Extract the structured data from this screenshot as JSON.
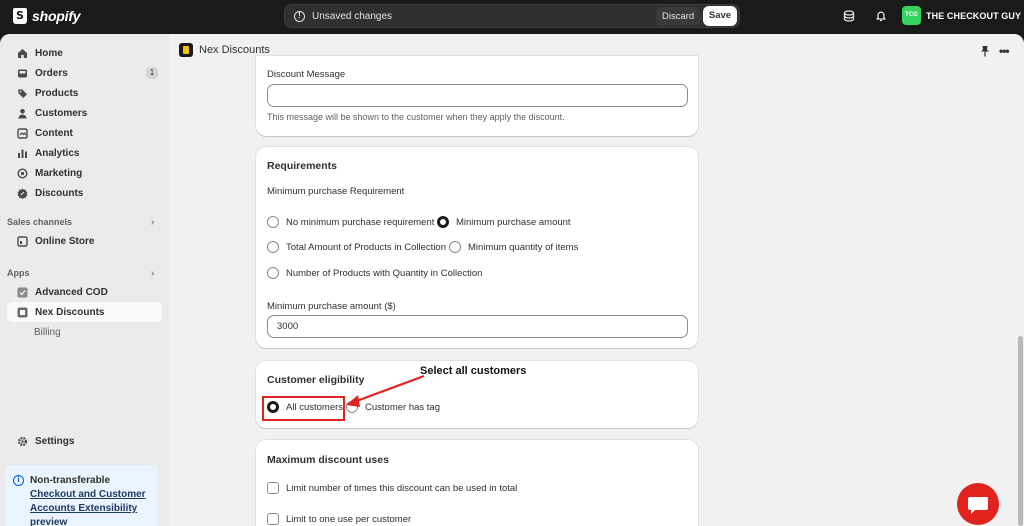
{
  "topbar": {
    "brand": "shopify",
    "unsaved_message": "Unsaved changes",
    "discard_label": "Discard",
    "save_label": "Save",
    "store_initials": "TCG",
    "store_name": "THE CHECKOUT GUY"
  },
  "sidebar": {
    "items": [
      {
        "label": "Home",
        "icon": "home-icon"
      },
      {
        "label": "Orders",
        "icon": "orders-icon",
        "count": "1"
      },
      {
        "label": "Products",
        "icon": "tag-icon"
      },
      {
        "label": "Customers",
        "icon": "person-icon"
      },
      {
        "label": "Content",
        "icon": "content-icon"
      },
      {
        "label": "Analytics",
        "icon": "bar-chart-icon"
      },
      {
        "label": "Marketing",
        "icon": "target-icon"
      },
      {
        "label": "Discounts",
        "icon": "discount-icon"
      }
    ],
    "sales_channels_heading": "Sales channels",
    "online_store": "Online Store",
    "apps_heading": "Apps",
    "apps": [
      {
        "label": "Advanced COD"
      },
      {
        "label": "Nex Discounts"
      }
    ],
    "billing": "Billing",
    "settings": "Settings",
    "notice": {
      "title": "Non-transferable",
      "link_line1": "Checkout and Customer",
      "link_line2": "Accounts Extensibility",
      "link_line3": "preview"
    }
  },
  "app_header": {
    "title": "Nex Discounts"
  },
  "discount_message_card": {
    "label": "Discount Message",
    "value": "",
    "help": "This message will be shown to the customer when they apply the discount."
  },
  "requirements_card": {
    "title": "Requirements",
    "subtitle": "Minimum purchase Requirement",
    "options": [
      {
        "label": "No minimum purchase requirement",
        "selected": false
      },
      {
        "label": "Minimum purchase amount",
        "selected": true
      },
      {
        "label": "Total Amount of Products in Collection",
        "selected": false
      },
      {
        "label": "Minimum quantity of items",
        "selected": false
      },
      {
        "label": "Number of Products with Quantity in Collection",
        "selected": false
      }
    ],
    "amount_label": "Minimum purchase amount ($)",
    "amount_value": "3000"
  },
  "eligibility_card": {
    "title": "Customer eligibility",
    "options": [
      {
        "label": "All customers",
        "selected": true
      },
      {
        "label": "Customer has tag",
        "selected": false
      }
    ]
  },
  "annotation": {
    "text": "Select all customers",
    "color": "#e02424"
  },
  "max_uses_card": {
    "title": "Maximum discount uses",
    "options": [
      {
        "label": "Limit number of times this discount can be used in total",
        "checked": false
      },
      {
        "label": "Limit to one use per customer",
        "checked": false
      }
    ]
  },
  "colors": {
    "topbar": "#1a1a1a",
    "store_badge": "#36d35f",
    "chat_button": "#e0231d",
    "notice_bg": "#eaf4ff"
  }
}
